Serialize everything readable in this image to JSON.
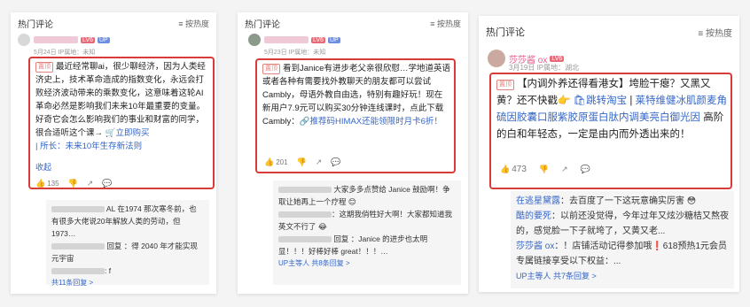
{
  "panel1": {
    "header_title": "热门评论",
    "sort_label": "按热度",
    "badge_lv": "LV6",
    "badge_up": "UP",
    "meta": "5月24日  IP属地：未知",
    "tag": "置顶",
    "comment": "最近经常聊ai，很少聊经济，因为人类经济史上，技术革命造成的指数变化，永远会打败经济波动带来的乘数变化，这意味着这轮AI革命必然是影响我们未来10年最重要的变量。好奇它会怎么影响我们的事业和财富的同学，很合适听这个课→ ",
    "buy_link": "立即购买",
    "buy_desc": "所长：未来10年生存新法则",
    "collapse": "收起",
    "likes": "135",
    "replies": [
      "AL 在1974 那次寒冬前，也有很多大佬说20年解放人类的劳动，但1973…",
      "回复 ：得 2040 年才能实现元宇宙",
      ": f"
    ],
    "more": "共11条回复 >"
  },
  "panel2": {
    "header_title": "热门评论",
    "sort_label": "按热度",
    "badge_lv": "LV6",
    "badge_up": "UP",
    "meta": "5月23日  IP属地：未知",
    "tag": "置顶",
    "comment": "看到Janice有进步老父亲很欣慰…学地道英语或者各种有需要找外教聊天的朋友都可以尝试Cambly，母语外教自由选，特别有趣好玩！现在新用户7.9元可以购买30分钟连线课时，点此下载Cambly：",
    "promo_link": "推荐码HIMAX还能领限时月卡6折！",
    "likes": "201",
    "replies": [
      "大家多多点赞给 Janice 鼓励啊！争取让她再上一个疗程 😊",
      "：这期我俏牲好大啊！大家都知道我英文不行了 😂",
      "回复 ：Janice 的进步也太明显！！！好棒好棒 great！！！…"
    ],
    "more": "UP主等人 共8条回复 >"
  },
  "panel3": {
    "header_title": "热门评论",
    "sort_label": "按热度",
    "user_name": "莎莎酱 ox",
    "badge_lv": "LV6",
    "meta": "3月19日  IP属地：湖北",
    "tag": "置顶",
    "comment": "【内调外养还得看港女】垮脸干瘪？又黑又黄？还不快戳👉 ",
    "link_taobao": "跳转淘宝",
    "link_product": "莱特维健冰肌颜麦角硫因胶囊口服紫胶原蛋白肽内调美亮白御光因",
    "comment_tail": " 高阶的白和年轻态，一定是由内而外透出来的！",
    "likes": "473",
    "replies": [
      {
        "name": "在逃星黛露",
        "text": "：去百度了一下这玩意确实厉害 😳"
      },
      {
        "name": "酷的要死",
        "text": "：以前还没觉得，今年过年又炫沙糖桔又熬夜的，感觉脸一下子就垮了，又黄又老..."
      },
      {
        "name": "莎莎酱 ox",
        "text": "：！店铺活动记得参加哦❗618预热1元会员专属链接享受以下权益：..."
      }
    ],
    "more": "UP主等人 共7条回复 >"
  }
}
